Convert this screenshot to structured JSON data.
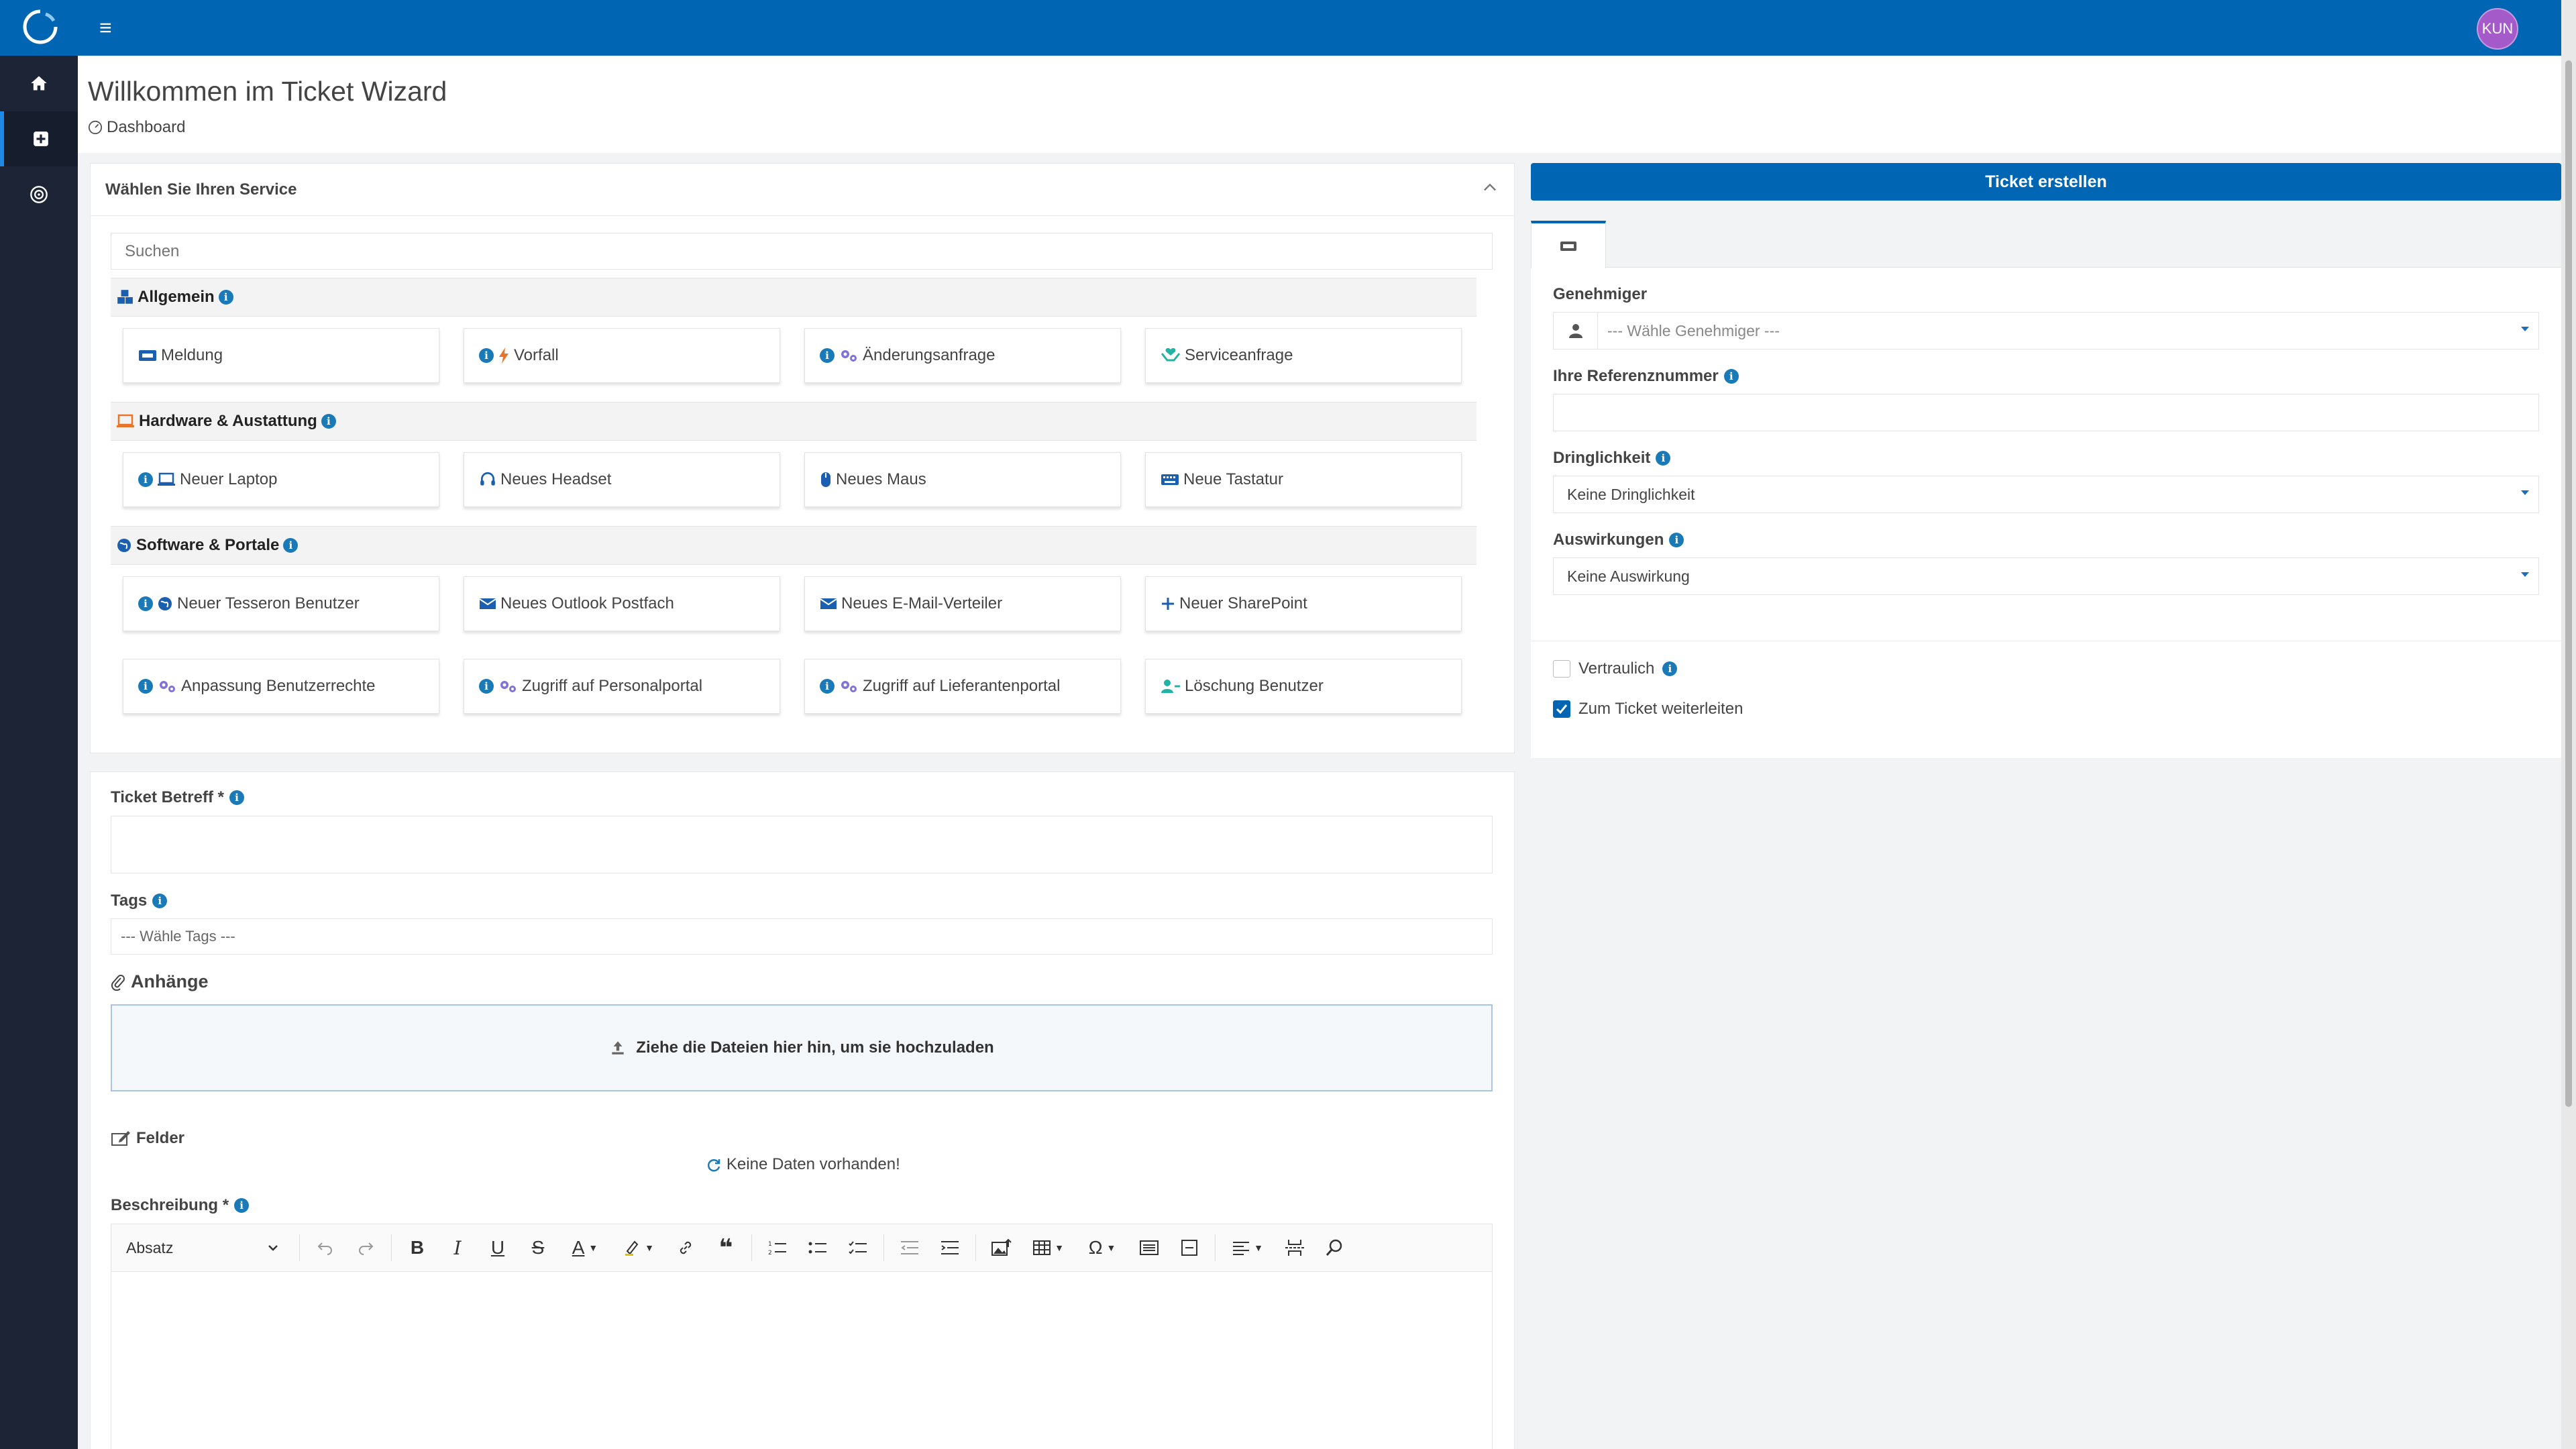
{
  "header": {
    "title": "Willkommen im Ticket Wizard",
    "breadcrumb": "Dashboard",
    "avatar": "KUN"
  },
  "sidebar": {
    "items": [
      {
        "icon": "home-icon"
      },
      {
        "icon": "add-ticket-icon",
        "active": true
      },
      {
        "icon": "target-icon"
      }
    ]
  },
  "service": {
    "title": "Wählen Sie Ihren Service",
    "search_placeholder": "Suchen",
    "categories": [
      {
        "label": "Allgemein",
        "items": [
          "Meldung",
          "Vorfall",
          "Änderungsanfrage",
          "Serviceanfrage"
        ]
      },
      {
        "label": "Hardware & Austattung",
        "items": [
          "Neuer Laptop",
          "Neues Headset",
          "Neues Maus",
          "Neue Tastatur"
        ]
      },
      {
        "label": "Software & Portale",
        "items": [
          "Neuer Tesseron Benutzer",
          "Neues Outlook Postfach",
          "Neues E-Mail-Verteiler",
          "Neuer SharePoint",
          "Anpassung Benutzerrechte",
          "Zugriff auf Personalportal",
          "Zugriff auf Lieferantenportal",
          "Löschung Benutzer"
        ]
      }
    ]
  },
  "form": {
    "subject_label": "Ticket Betreff *",
    "tags_label": "Tags",
    "tags_placeholder": "--- Wähle Tags ---",
    "attachments_label": "Anhänge",
    "dropzone_text": "Ziehe die Dateien hier hin, um sie hochzuladen",
    "fields_label": "Felder",
    "no_data": "Keine Daten vorhanden!",
    "description_label": "Beschreibung *",
    "paragraph_select": "Absatz"
  },
  "right": {
    "create_button": "Ticket erstellen",
    "approver_label": "Genehmiger",
    "approver_placeholder": "--- Wähle Genehmiger ---",
    "reference_label": "Ihre Referenznummer",
    "urgency_label": "Dringlichkeit",
    "urgency_value": "Keine Dringlichkeit",
    "impact_label": "Auswirkungen",
    "impact_value": "Keine Auswirkung",
    "confidential_label": "Vertraulich",
    "confidential_checked": false,
    "forward_label": "Zum Ticket weiterleiten",
    "forward_checked": true
  },
  "colors": {
    "brand": "#0066b3",
    "sidebar": "#1c2436",
    "info": "#1a7ab8",
    "avatar": "#a45bc9"
  }
}
